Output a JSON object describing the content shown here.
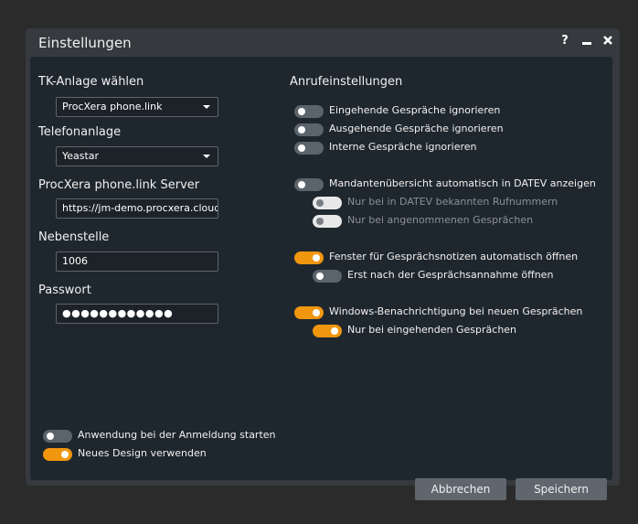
{
  "window": {
    "title": "Einstellungen",
    "help_label": "?",
    "minimize_label": "‒",
    "close_label": "✖"
  },
  "left": {
    "tk_label": "TK-Anlage wählen",
    "tk_value": "ProcXera phone.link",
    "telefon_label": "Telefonanlage",
    "telefon_value": "Yeastar",
    "server_label": "ProcXera phone.link Server",
    "server_value": "https://jm-demo.procxera.cloud/",
    "nebenstelle_label": "Nebenstelle",
    "nebenstelle_value": "1006",
    "passwort_label": "Passwort",
    "passwort_value": "●●●●●●●●●●●●"
  },
  "right": {
    "section_title": "Anrufeinstellungen",
    "toggles": [
      {
        "label": "Eingehende Gespräche ignorieren",
        "state": "off"
      },
      {
        "label": "Ausgehende Gespräche ignorieren",
        "state": "off"
      },
      {
        "label": "Interne Gespräche ignorieren",
        "state": "off"
      },
      {
        "label": "Mandantenübersicht automatisch in DATEV anzeigen",
        "state": "off"
      },
      {
        "label": "Nur bei in DATEV bekannten Rufnummern",
        "state": "disabled"
      },
      {
        "label": "Nur bei angenommenen Gesprächen",
        "state": "disabled"
      },
      {
        "label": "Fenster für Gesprächsnotizen automatisch öffnen",
        "state": "on"
      },
      {
        "label": "Erst nach der Gesprächsannahme öffnen",
        "state": "off"
      },
      {
        "label": "Windows-Benachrichtigung bei neuen Gesprächen",
        "state": "on"
      },
      {
        "label": "Nur bei eingehenden Gesprächen",
        "state": "on"
      }
    ]
  },
  "bottom": {
    "toggles": [
      {
        "label": "Anwendung bei der Anmeldung starten",
        "state": "off"
      },
      {
        "label": "Neues Design verwenden",
        "state": "on"
      }
    ],
    "cancel_label": "Abbrechen",
    "save_label": "Speichern"
  },
  "colors": {
    "accent": "#f0960f",
    "panel": "#1f272e",
    "window": "#36393d"
  }
}
